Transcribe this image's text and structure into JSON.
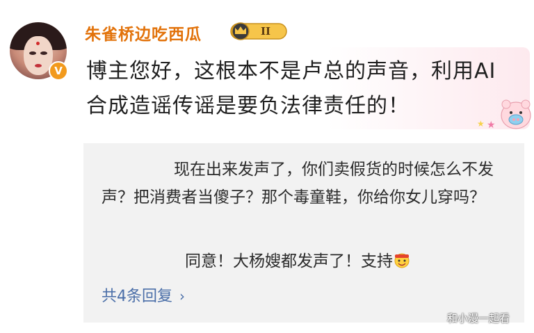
{
  "comment": {
    "username": "朱雀桥边吃西瓜",
    "rank_badge": "II",
    "text": "博主您好，这根本不是卢总的声音，利用AI合成造谣传谣是要负法律责任的！"
  },
  "replies": {
    "reply1": "现在出来发声了，你们卖假货的时候怎么不发声？把消费者当傻子？那个毒童鞋，你给你女儿穿吗？",
    "reply2": "同意！大杨嫂都发声了！支持",
    "more_link": "共4条回复",
    "chevron": "›"
  },
  "watermark": "和小漫一起看",
  "colors": {
    "username": "#e2720a",
    "link": "#4a6ea8",
    "reply_bg": "#f2f2f2",
    "verified_badge": "#f29a1d"
  },
  "icons": {
    "avatar": "avatar-image",
    "verified": "verified-v-icon",
    "rank": "crown-rank-icon",
    "sticker": "pig-sticker-icon",
    "emoji": "cheering-emoji-icon"
  }
}
